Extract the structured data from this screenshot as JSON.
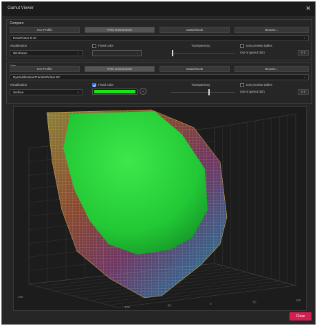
{
  "window": {
    "title": "Gamut Viewer",
    "close_glyph": "✕"
  },
  "compare": {
    "section_label": "Compare",
    "tabs": [
      {
        "label": "ICC Profile",
        "active": false
      },
      {
        "label": "Print environment",
        "active": true
      },
      {
        "label": "Swatchbook",
        "active": false
      },
      {
        "label": "Browse...",
        "active": false
      }
    ],
    "profile_value": "PosePrinter 8 4C",
    "visualization_label": "Visualization",
    "visualization_value": "Wireframe",
    "fixed_color_label": "Fixed color",
    "fixed_color_checked": false,
    "transparency_label": "Transparency",
    "transparency_level": 0.03,
    "use_preview_label": "Use preview tables",
    "use_preview_checked": false,
    "out_of_gamut_label": "Out of gamut (dE)",
    "out_of_gamut_value": "0.5"
  },
  "use": {
    "section_label": "Use",
    "tabs": [
      {
        "label": "ICC Profile",
        "active": false
      },
      {
        "label": "Print environment",
        "active": true
      },
      {
        "label": "Swatchbook",
        "active": false
      },
      {
        "label": "Browse...",
        "active": false
      }
    ],
    "profile_value": "DyeSublimationTransferPrinter 8C",
    "visualization_label": "Visualization",
    "visualization_value": "Surface",
    "fixed_color_label": "Fixed color",
    "fixed_color_checked": true,
    "fixed_color_hex": "#19e419",
    "transparency_label": "Transparency",
    "transparency_level": 0.6,
    "use_preview_label": "Use preview tables",
    "use_preview_checked": false,
    "out_of_gamut_label": "Out of gamut (dE)",
    "out_of_gamut_value": "0.5"
  },
  "viewport": {
    "axis_labels": [
      "-100",
      "-50",
      "0",
      "50",
      "100"
    ],
    "left_label": "100"
  },
  "colors": {
    "accent": "#d32052",
    "gamut_fill": "#27c83a"
  },
  "footer": {
    "close_label": "Close"
  }
}
